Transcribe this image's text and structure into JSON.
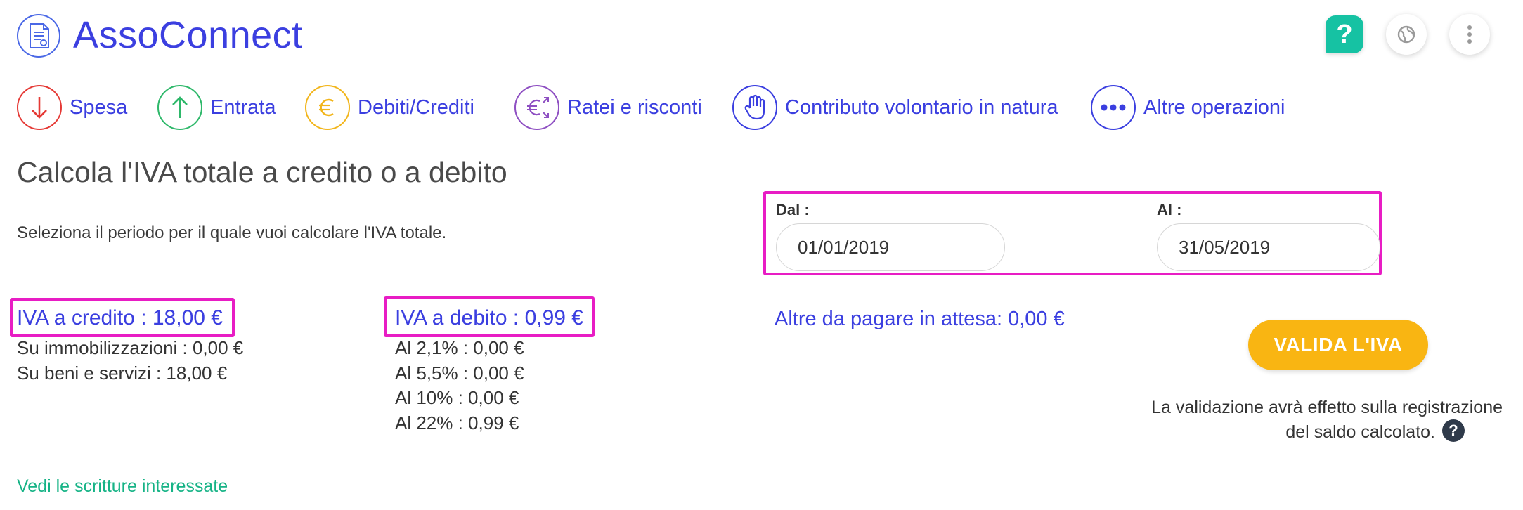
{
  "header": {
    "brand": "AssoConnect",
    "help_label": "?",
    "colors": {
      "brand": "#3b3fe0",
      "help": "#16c2a3"
    }
  },
  "toolbar": {
    "items": [
      {
        "label": "Spesa",
        "icon": "arrow-down-icon",
        "color": "#e53935"
      },
      {
        "label": "Entrata",
        "icon": "arrow-up-icon",
        "color": "#2eb86a"
      },
      {
        "label": "Debiti/Crediti",
        "icon": "euro-icon",
        "color": "#f2b51a"
      },
      {
        "label": "Ratei e risconti",
        "icon": "euro-cycle-icon",
        "color": "#8e4fc2"
      },
      {
        "label": "Contributo volontario in natura",
        "icon": "hand-icon",
        "color": "#3b3fe0"
      },
      {
        "label": "Altre operazioni",
        "icon": "more-dots-icon",
        "color": "#3b3fe0"
      }
    ]
  },
  "main": {
    "title": "Calcola l'IVA totale a credito o a debito",
    "subtitle": "Seleziona il periodo per il quale vuoi calcolare l'IVA totale.",
    "period": {
      "from_label": "Dal :",
      "from_value": "01/01/2019",
      "to_label": "Al :",
      "to_value": "31/05/2019"
    },
    "credit": {
      "heading": "IVA a credito : 18,00 €",
      "lines": [
        "Su immobilizzazioni : 0,00 €",
        "Su beni e servizi : 18,00 €"
      ]
    },
    "debit": {
      "heading": "IVA a debito : 0,99 €",
      "lines": [
        "Al 2,1% : 0,00 €",
        "Al 5,5% : 0,00 €",
        "Al 10% : 0,00 €",
        "Al 22% : 0,99 €"
      ]
    },
    "pending": "Altre da pagare in attesa: 0,00 €",
    "validate_button": "VALIDA L'IVA",
    "note_line1": "La validazione avrà effetto sulla registrazione",
    "note_line2": "del saldo calcolato.",
    "note_help": "?",
    "link": "Vedi le scritture interessate"
  },
  "colors": {
    "highlight": "#e81dc4",
    "accent_button": "#f9b512",
    "link": "#16b386"
  }
}
